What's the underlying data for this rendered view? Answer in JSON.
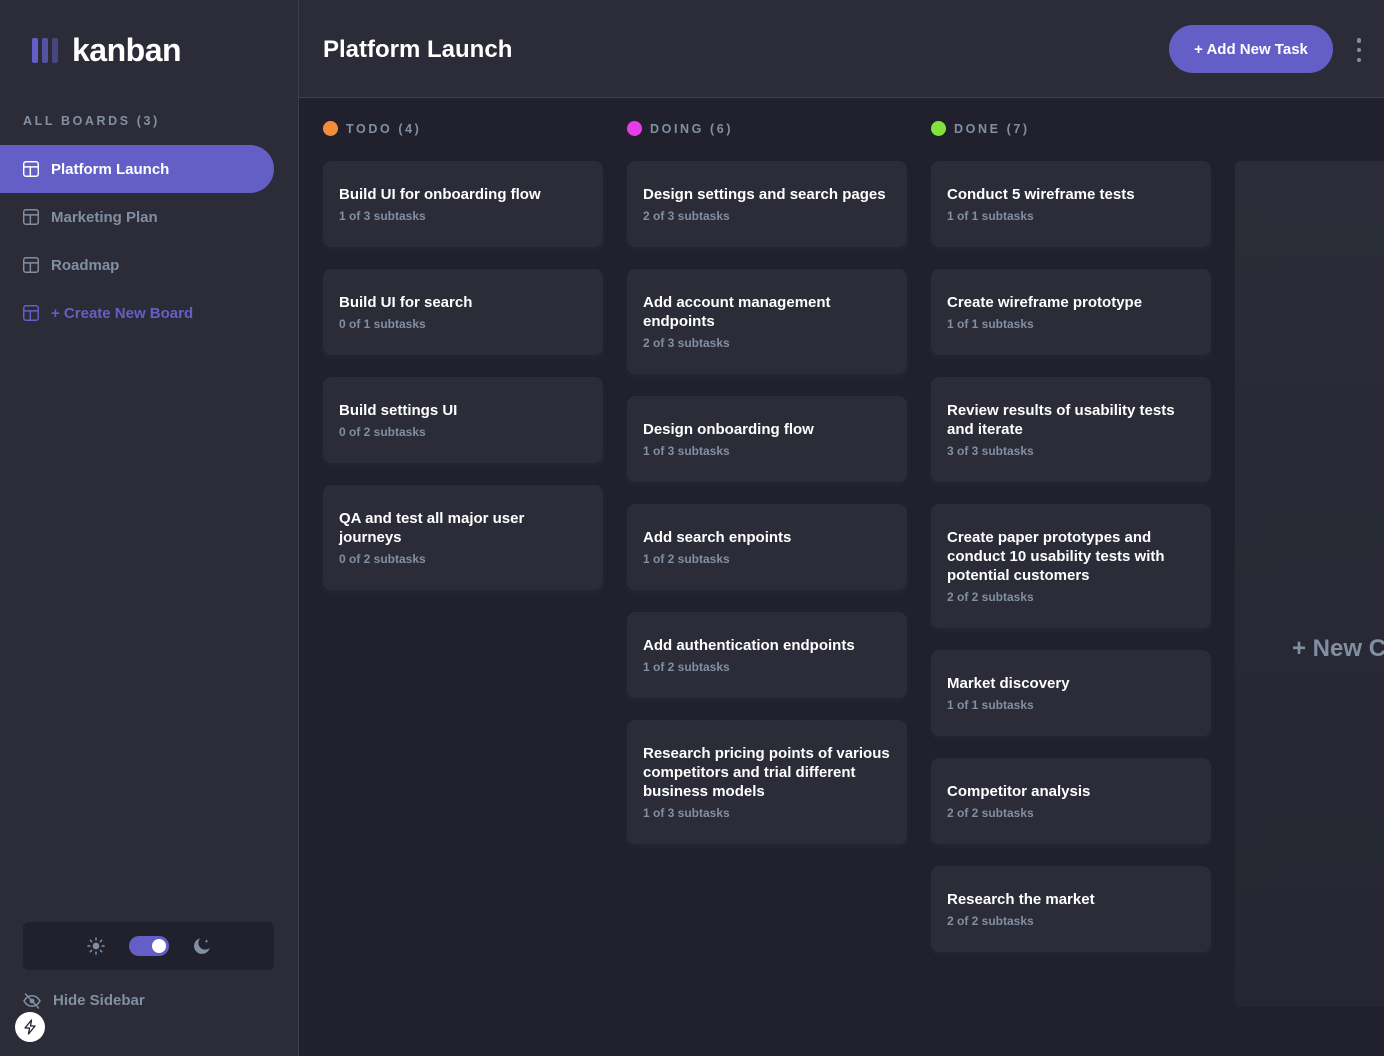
{
  "app": {
    "name": "kanban"
  },
  "sidebar": {
    "heading": "ALL BOARDS (3)",
    "boards": [
      {
        "label": "Platform Launch",
        "active": true
      },
      {
        "label": "Marketing Plan",
        "active": false
      },
      {
        "label": "Roadmap",
        "active": false
      }
    ],
    "create_label": "+ Create New Board",
    "hide_label": "Hide Sidebar",
    "icons": {
      "board": "board-icon",
      "light": "sun-icon",
      "dark": "moon-icon",
      "hide": "eye-slash-icon",
      "badge": "bolt-icon"
    }
  },
  "header": {
    "title": "Platform Launch",
    "add_task_label": "+ Add New Task",
    "menu_icon": "vertical-ellipsis-icon"
  },
  "columns": [
    {
      "name": "TODO (4)",
      "color": "#f38d3c",
      "tasks": [
        {
          "title": "Build UI for onboarding flow",
          "subtasks": "1 of 3 subtasks"
        },
        {
          "title": "Build UI for search",
          "subtasks": "0 of 1 subtasks"
        },
        {
          "title": "Build settings UI",
          "subtasks": "0 of 2 subtasks"
        },
        {
          "title": "QA and test all major user journeys",
          "subtasks": "0 of 2 subtasks"
        }
      ]
    },
    {
      "name": "DOING (6)",
      "color": "#e53ee8",
      "tasks": [
        {
          "title": "Design settings and search pages",
          "subtasks": "2 of 3 subtasks"
        },
        {
          "title": "Add account management endpoints",
          "subtasks": "2 of 3 subtasks"
        },
        {
          "title": "Design onboarding flow",
          "subtasks": "1 of 3 subtasks"
        },
        {
          "title": "Add search enpoints",
          "subtasks": "1 of 2 subtasks"
        },
        {
          "title": "Add authentication endpoints",
          "subtasks": "1 of 2 subtasks"
        },
        {
          "title": "Research pricing points of various competitors and trial different business models",
          "subtasks": "1 of 3 subtasks"
        }
      ]
    },
    {
      "name": "DONE (7)",
      "color": "#84e23f",
      "tasks": [
        {
          "title": "Conduct 5 wireframe tests",
          "subtasks": "1 of 1 subtasks"
        },
        {
          "title": "Create wireframe prototype",
          "subtasks": "1 of 1 subtasks"
        },
        {
          "title": "Review results of usability tests and iterate",
          "subtasks": "3 of 3 subtasks"
        },
        {
          "title": "Create paper prototypes and conduct 10 usability tests with potential customers",
          "subtasks": "2 of 2 subtasks"
        },
        {
          "title": "Market discovery",
          "subtasks": "1 of 1 subtasks"
        },
        {
          "title": "Competitor analysis",
          "subtasks": "2 of 2 subtasks"
        },
        {
          "title": "Research the market",
          "subtasks": "2 of 2 subtasks"
        }
      ]
    }
  ],
  "new_column_label": "+ New Column",
  "theme": {
    "accent": "#635fc7",
    "dark_mode": true
  }
}
